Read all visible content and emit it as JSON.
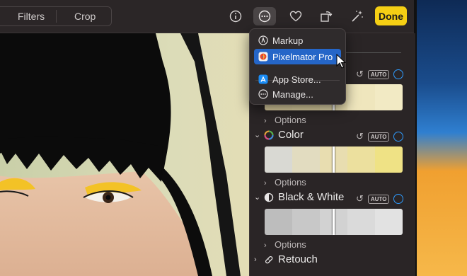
{
  "toolbar": {
    "tab_filters": "Filters",
    "tab_crop": "Crop",
    "done_label": "Done",
    "accent_color": "#f5cf14"
  },
  "menu": {
    "items": [
      {
        "label": "Markup",
        "icon": "markup-icon"
      },
      {
        "label": "Pixelmator Pro",
        "icon": "pixelmator-pro-icon",
        "highlighted": true
      },
      {
        "label": "App Store...",
        "icon": "app-store-icon"
      },
      {
        "label": "Manage...",
        "icon": "more-icon"
      }
    ],
    "highlight_color": "#2566c8"
  },
  "panel": {
    "auto_label": "AUTO",
    "options_label": "Options",
    "sections": [
      {
        "title": "Color"
      },
      {
        "title": "Black & White"
      },
      {
        "title": "Retouch"
      }
    ]
  }
}
